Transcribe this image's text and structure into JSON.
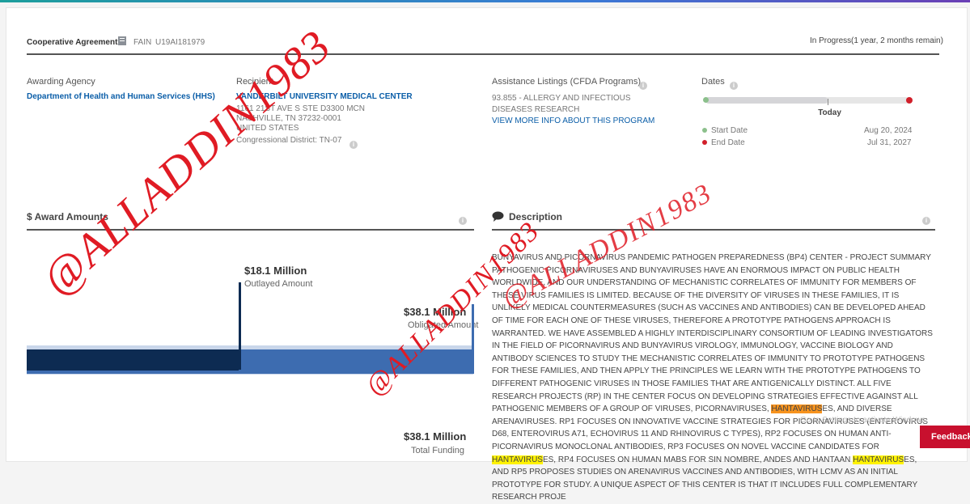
{
  "header": {
    "type": "Cooperative Agreement",
    "fain_label": "FAIN",
    "fain": "U19AI181979",
    "status": "In Progress",
    "status_detail": "(1 year, 2 months remain)"
  },
  "awarding": {
    "label": "Awarding Agency",
    "value": "Department of Health and Human Services (HHS)"
  },
  "recipient": {
    "label": "Recipient",
    "name": "VANDERBILT UNIVERSITY MEDICAL CENTER",
    "address1": "1161 21ST AVE S STE D3300 MCN",
    "address2": "NASHVILLE, TN 37232-0001",
    "address3": "UNITED STATES",
    "district": "Congressional District: TN-07"
  },
  "assistance": {
    "label": "Assistance Listings (CFDA Programs)",
    "value": "93.855 - ALLERGY AND INFECTIOUS DISEASES RESEARCH",
    "link": "VIEW MORE INFO ABOUT THIS PROGRAM"
  },
  "dates": {
    "label": "Dates",
    "today": "Today",
    "start_label": "Start Date",
    "start": "Aug 20, 2024",
    "end_label": "End Date",
    "end": "Jul 31, 2027",
    "progress": 0.6
  },
  "award_amounts": {
    "title": "$ Award Amounts",
    "outlayed_value": "$18.1 Million",
    "outlayed_label": "Outlayed Amount",
    "obligated_value": "$38.1 Million",
    "obligated_label": "Obligated Amount",
    "total_value": "$38.1 Million",
    "total_label": "Total Funding",
    "outlayed_fraction": 0.475
  },
  "description": {
    "title": "Description",
    "part1": "BUNYAVIRUS AND PICORNAVIRUS PANDEMIC PATHOGEN PREPAREDNESS (BP4) CENTER - PROJECT SUMMARY PATHOGENIC PICORNAVIRUSES AND BUNYAVIRUSES HAVE AN ENORMOUS IMPACT ON PUBLIC HEALTH WORLDWIDE, AND OUR UNDERSTANDING OF MECHANISTIC CORRELATES OF IMMUNITY FOR MEMBERS OF THESE VIRUS FAMILIES IS LIMITED. BECAUSE OF THE DIVERSITY OF VIRUSES IN THESE FAMILIES, IT IS UNLIKELY MEDICAL COUNTERMEASURES (SUCH AS VACCINES AND ANTIBODIES) CAN BE DEVELOPED AHEAD OF TIME FOR EACH ONE OF THESE VIRUSES, THEREFORE A PROTOTYPE PATHOGENS APPROACH IS WARRANTED. WE HAVE ASSEMBLED A HIGHLY INTERDISCIPLINARY CONSORTIUM OF LEADING INVESTIGATORS IN THE FIELD OF PICORNAVIRUS AND BUNYAVIRUS VIROLOGY, IMMUNOLOGY, VACCINE BIOLOGY AND ANTIBODY SCIENCES TO STUDY THE MECHANISTIC CORRELATES OF IMMUNITY TO PROTOTYPE PATHOGENS FOR THESE FAMILIES, AND THEN APPLY THE PRINCIPLES WE LEARN WITH THE PROTOTYPE PATHOGENS TO DIFFERENT PATHOGENIC VIRUSES IN THOSE FAMILIES THAT ARE ANTIGENICALLY DISTINCT. ALL FIVE RESEARCH PROJECTS (RP) IN THE CENTER FOCUS ON DEVELOPING STRATEGIES EFFECTIVE AGAINST ALL PATHOGENIC MEMBERS OF A GROUP OF VIRUSES, PICORNAVIRUSES, ",
    "hl1": "HANTAVIRUS",
    "part2": "ES, AND DIVERSE ARENAVIRUSES. RP1 FOCUSES ON INNOVATIVE VACCINE STRATEGIES FOR PICORNAVIRUSES (ENTEROVIRUS D68, ENTEROVIRUS A71, ECHOVIRUS 11 AND RHINOVIRUS C TYPES), RP2 FOCUSES ON HUMAN ANTI-PICORNAVIRUS MONOCLONAL ANTIBODIES, RP3 FOCUSES ON NOVEL VACCINE CANDIDATES FOR ",
    "hl2": "HANTAVIRUS",
    "part3": "ES, RP4 FOCUSES ON HUMAN MABS FOR SIN NOMBRE, ANDES AND HANTAAN ",
    "hl3": "HANTAVIRUS",
    "part4": "ES, AND RP5 PROPOSES STUDIES ON ARENAVIRUS VACCINES AND ANTIBODIES, WITH LCMV AS AN INITIAL PROTOTYPE FOR STUDY. A UNIQUE ASPECT OF THIS CENTER IS THAT IT INCLUDES FULL COMPLEMENTARY RESEARCH PROJE"
  },
  "watermark": "@ALLADDIN1983",
  "overlay": {
    "activate": "Go to Settings to activate Windows.",
    "feedback": "Feedback"
  },
  "colors": {
    "outlayed": "#0d2b52",
    "obligated": "#3d6cb0",
    "total_bg": "#c9d6ea",
    "start_dot": "#8cc08c",
    "end_dot": "#d11f2a"
  }
}
